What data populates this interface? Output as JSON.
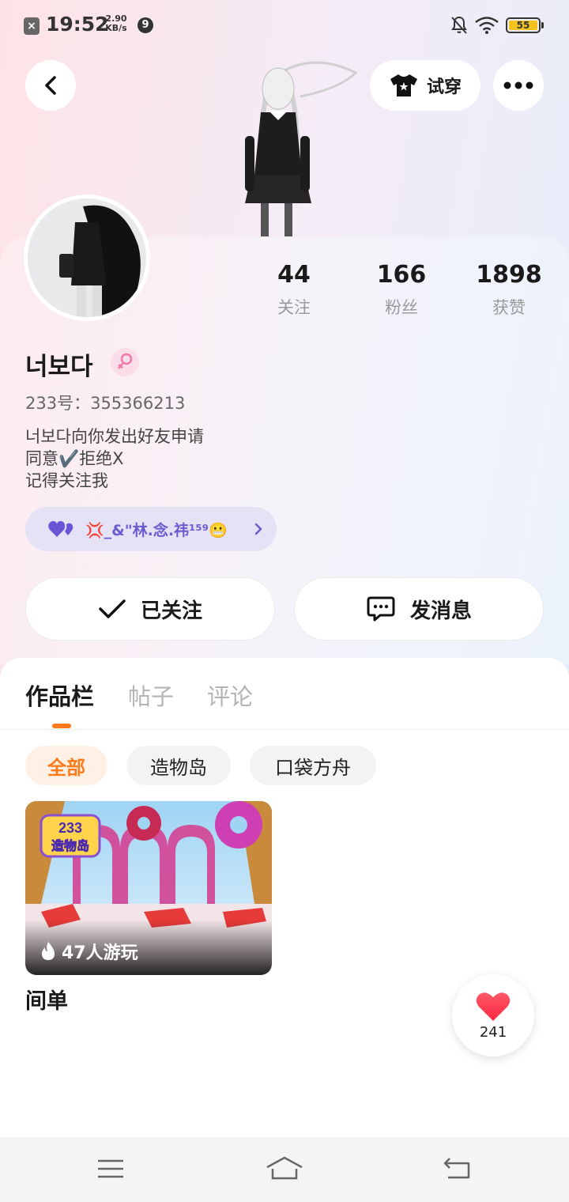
{
  "status_bar": {
    "time": "19:52",
    "net_speed_value": "2.90",
    "net_speed_unit": "KB/s",
    "notification_badge": "9",
    "battery": "55"
  },
  "header": {
    "try_on_label": "试穿"
  },
  "profile": {
    "stats": [
      {
        "value": "44",
        "label": "关注"
      },
      {
        "value": "166",
        "label": "粉丝"
      },
      {
        "value": "1898",
        "label": "获赞"
      }
    ],
    "username": "너보다",
    "user_id": "233号：355366213",
    "bio_lines": [
      "너보다向你发出好友申请",
      "同意✔️拒绝X",
      "记得关注我"
    ],
    "friend_name": "💢_&\"林.念.祎¹⁵⁹😬"
  },
  "actions": {
    "follow_label": "已关注",
    "message_label": "发消息"
  },
  "tabs": [
    {
      "label": "作品栏",
      "active": true
    },
    {
      "label": "帖子",
      "active": false
    },
    {
      "label": "评论",
      "active": false
    }
  ],
  "filters": [
    {
      "label": "全部",
      "active": true
    },
    {
      "label": "造物岛",
      "active": false
    },
    {
      "label": "口袋方舟",
      "active": false
    }
  ],
  "works": [
    {
      "title": "间单",
      "plays": "47人游玩",
      "logo_line1": "233",
      "logo_line2": "造物岛"
    }
  ],
  "like_fab": {
    "count": "241"
  },
  "colors": {
    "accent": "#ff7a1a",
    "friend_pill": "#e6e2f6",
    "friend_text": "#6a5bd0"
  }
}
